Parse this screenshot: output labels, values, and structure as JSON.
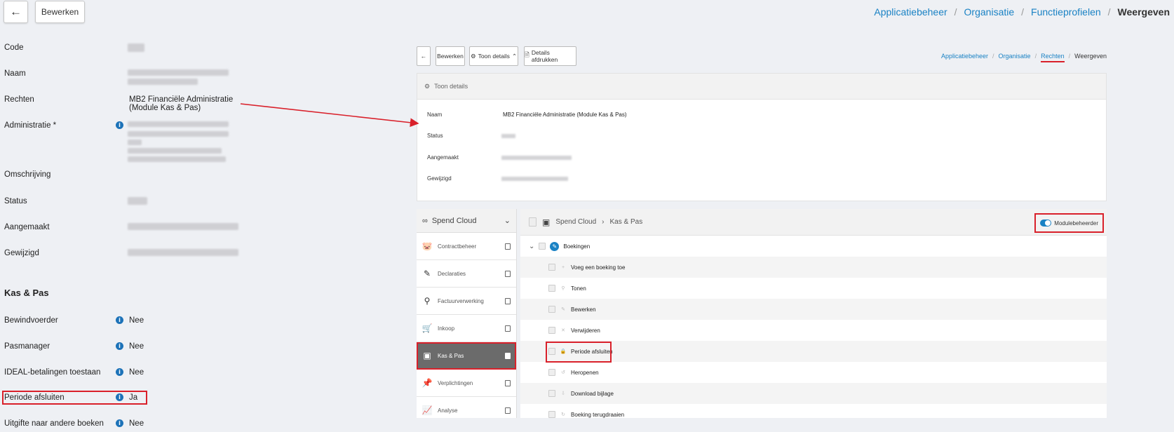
{
  "topbar": {
    "back_icon": "←",
    "edit_label": "Bewerken",
    "breadcrumb": [
      "Applicatiebeheer",
      "Organisatie",
      "Functieprofielen",
      "Weergeven"
    ]
  },
  "left": {
    "fields": {
      "code": "Code",
      "naam": "Naam",
      "rechten": "Rechten",
      "rechten_value_1": "MB2 Financiële Administratie",
      "rechten_value_2": "(Module Kas & Pas)",
      "administratie": "Administratie *",
      "omschrijving": "Omschrijving",
      "status": "Status",
      "aangemaakt": "Aangemaakt",
      "gewijzigd": "Gewijzigd"
    },
    "section_title": "Kas & Pas",
    "settings": [
      {
        "label": "Bewindvoerder",
        "value": "Nee"
      },
      {
        "label": "Pasmanager",
        "value": "Nee"
      },
      {
        "label": "IDEAL-betalingen toestaan",
        "value": "Nee"
      },
      {
        "label": "Periode afsluiten",
        "value": "Ja"
      },
      {
        "label": "Uitgifte naar andere boeken",
        "value": "Nee"
      }
    ],
    "info_glyph": "i"
  },
  "inner": {
    "edit_label": "Bewerken",
    "toon_details_label": "Toon details",
    "print_label": "Details afdrukken",
    "breadcrumb": [
      "Applicatiebeheer",
      "Organisatie",
      "Rechten",
      "Weergeven"
    ],
    "details": {
      "header": "Toon details",
      "naam_label": "Naam",
      "naam_value": "MB2 Financiële Administratie (Module Kas & Pas)",
      "status_label": "Status",
      "aangemaakt_label": "Aangemaakt",
      "gewijzigd_label": "Gewijzigd"
    },
    "modules_title": "Spend Cloud",
    "modules": [
      {
        "label": "Contractbeheer",
        "icon": "🐷"
      },
      {
        "label": "Declaraties",
        "icon": "✎"
      },
      {
        "label": "Factuurverwerking",
        "icon": "⚲"
      },
      {
        "label": "Inkoop",
        "icon": "🛒"
      },
      {
        "label": "Kas & Pas",
        "icon": "▣"
      },
      {
        "label": "Verplichtingen",
        "icon": "📌"
      },
      {
        "label": "Analyse",
        "icon": "📈"
      }
    ],
    "perm_breadcrumb_root": "Spend Cloud",
    "perm_breadcrumb_sep": "›",
    "perm_breadcrumb_leaf": "Kas & Pas",
    "toggle_label": "Modulebeheerder",
    "group_label": "Boekingen",
    "permissions": [
      {
        "label": "Voeg een boeking toe",
        "icon": "+"
      },
      {
        "label": "Tonen",
        "icon": "⚲"
      },
      {
        "label": "Bewerken",
        "icon": "✎"
      },
      {
        "label": "Verwijderen",
        "icon": "✕"
      },
      {
        "label": "Periode afsluiten",
        "icon": "🔒"
      },
      {
        "label": "Heropenen",
        "icon": "↺"
      },
      {
        "label": "Download bijlage",
        "icon": "⇩"
      },
      {
        "label": "Boeking terugdraaien",
        "icon": "↻"
      }
    ]
  },
  "colors": {
    "link": "#1a82c4",
    "highlight": "#d9202a",
    "info": "#1c72b8"
  }
}
